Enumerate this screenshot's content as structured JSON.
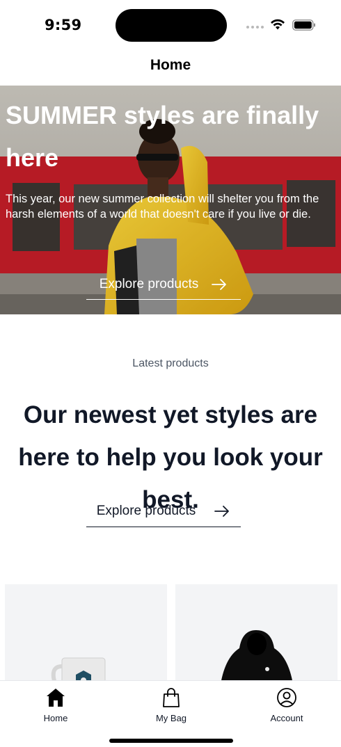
{
  "status_bar": {
    "time": "9:59"
  },
  "nav": {
    "title": "Home"
  },
  "hero": {
    "title": "SUMMER styles are finally here",
    "text": "This year, our new summer collection will shelter you from the harsh elements of a world that doesn't care if you live or die.",
    "cta_label": "Explore products"
  },
  "latest": {
    "label": "Latest products",
    "heading": "Our newest yet styles are here to help you look your best.",
    "cta_label": "Explore products"
  },
  "products": [
    {
      "icon": "mug-icon"
    },
    {
      "icon": "hoodie-icon"
    }
  ],
  "tabs": [
    {
      "label": "Home",
      "icon": "home-icon"
    },
    {
      "label": "My Bag",
      "icon": "bag-icon"
    },
    {
      "label": "Account",
      "icon": "account-icon"
    }
  ],
  "colors": {
    "text_dark": "#111827",
    "text_muted": "#4b5563",
    "product_bg": "#f3f4f6",
    "hero_accent_red": "#c8202b",
    "hero_accent_yellow": "#f2c81a"
  }
}
